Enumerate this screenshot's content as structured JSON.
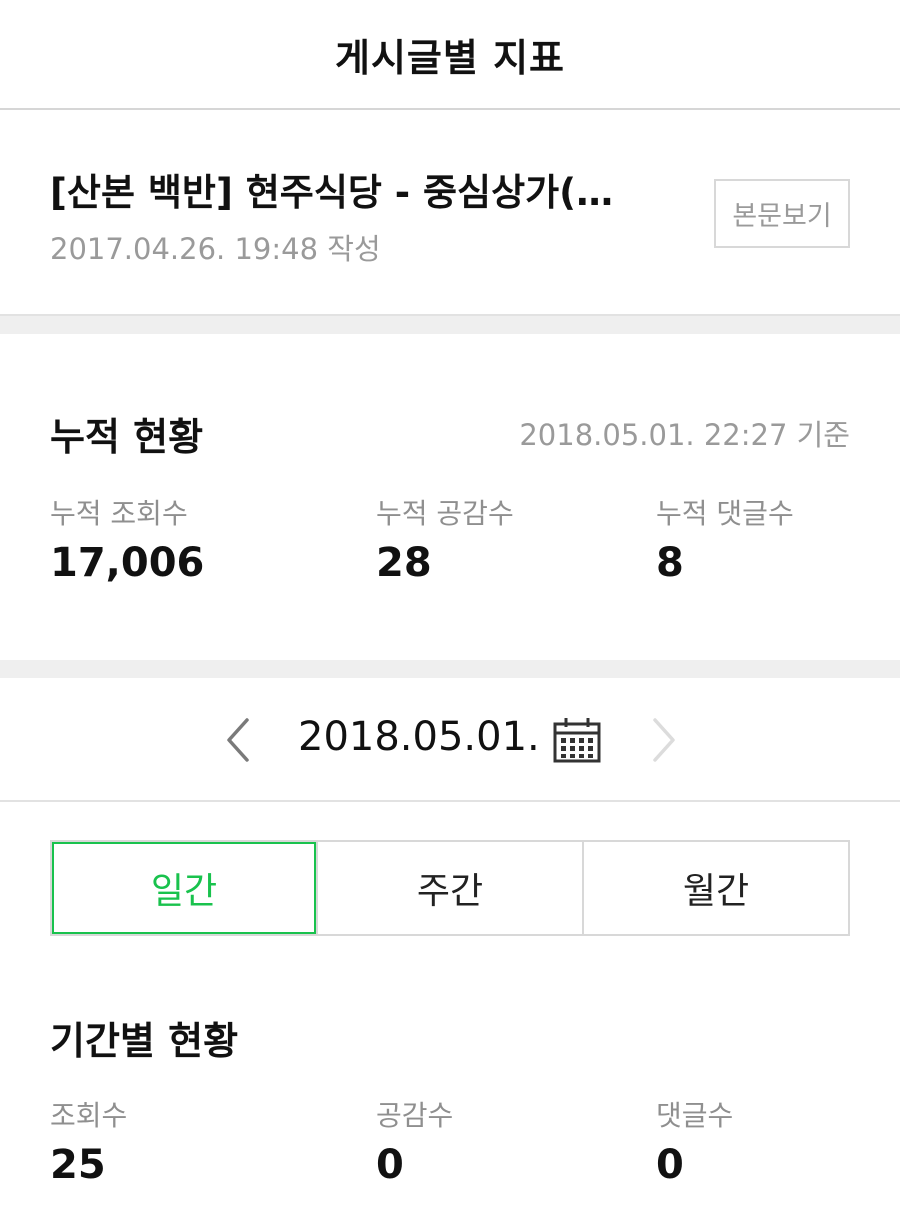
{
  "header": {
    "title": "게시글별 지표"
  },
  "post": {
    "title": "[산본 백반] 현주식당 - 중심상가(…",
    "date": "2017.04.26. 19:48 작성",
    "view_button": "본문보기"
  },
  "cumulative": {
    "title": "누적 현황",
    "as_of": "2018.05.01. 22:27 기준",
    "stats": [
      {
        "label": "누적 조회수",
        "value": "17,006"
      },
      {
        "label": "누적 공감수",
        "value": "28"
      },
      {
        "label": "누적 댓글수",
        "value": "8"
      }
    ]
  },
  "date_nav": {
    "date": "2018.05.01.",
    "prev_icon": "chevron-left-icon",
    "next_icon": "chevron-right-icon",
    "calendar_icon": "calendar-icon",
    "next_disabled": true
  },
  "tabs": [
    {
      "label": "일간",
      "active": true
    },
    {
      "label": "주간",
      "active": false
    },
    {
      "label": "월간",
      "active": false
    }
  ],
  "period": {
    "title": "기간별 현황",
    "stats": [
      {
        "label": "조회수",
        "value": "25"
      },
      {
        "label": "공감수",
        "value": "0"
      },
      {
        "label": "댓글수",
        "value": "0"
      }
    ]
  },
  "colors": {
    "accent": "#19c24d",
    "muted_text": "#9a9a9a",
    "divider": "#efefef"
  }
}
